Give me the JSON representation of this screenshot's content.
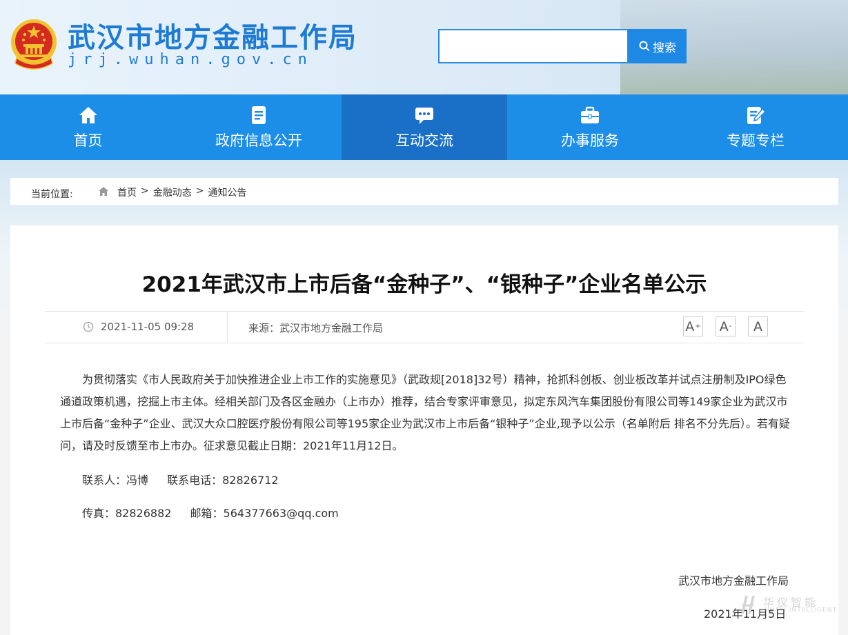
{
  "header": {
    "site_title": "武汉市地方金融工作局",
    "site_domain": "jrj.wuhan.gov.cn",
    "search": {
      "value": "",
      "button_label": "搜索"
    }
  },
  "nav": {
    "items": [
      {
        "label": "首页",
        "icon": "home-icon"
      },
      {
        "label": "政府信息公开",
        "icon": "document-icon"
      },
      {
        "label": "互动交流",
        "icon": "chat-icon",
        "active": true
      },
      {
        "label": "办事服务",
        "icon": "briefcase-icon"
      },
      {
        "label": "专题专栏",
        "icon": "edit-icon"
      }
    ]
  },
  "breadcrumb": {
    "label": "当前位置:",
    "items": [
      "首页",
      "金融动态",
      "通知公告"
    ],
    "separator": ">"
  },
  "article": {
    "title": "2021年武汉市上市后备“金种子”、“银种子”企业名单公示",
    "date": "2021-11-05 09:28",
    "source": "来源：武汉市地方金融工作局",
    "font_size_buttons": [
      "A",
      "A",
      "A"
    ],
    "paragraph": "为贯彻落实《市人民政府关于加快推进企业上市工作的实施意见》（武政规[2018]32号）精神，抢抓科创板、创业板改革并试点注册制及IPO绿色通道政策机遇，挖掘上市主体。经相关部门及各区金融办（上市办）推荐，结合专家评审意见，拟定东风汽车集团股份有限公司等149家企业为武汉市上市后备“金种子”企业、武汉大众口腔医疗股份有限公司等195家企业为武汉市上市后备“银种子”企业,现予以公示（名单附后 排名不分先后）。若有疑问，请及时反馈至市上市办。征求意见截止日期：2021年11月12日。",
    "contact_person": "联系人：冯博",
    "contact_phone": "联系电话：82826712",
    "fax": "传真：82826882",
    "email": "邮箱：564377663@qq.com",
    "sign_org": "武汉市地方金融工作局",
    "sign_date": "2021年11月5日"
  },
  "watermark": {
    "cn": "华仪智能",
    "en": "HUAYI INTELLIGENT"
  },
  "colors": {
    "primary": "#1c8ee8",
    "nav_active": "#1a6fc7",
    "title_blue": "#1e7bd4",
    "emblem_red": "#d42a1f",
    "emblem_gold": "#f2c230"
  }
}
